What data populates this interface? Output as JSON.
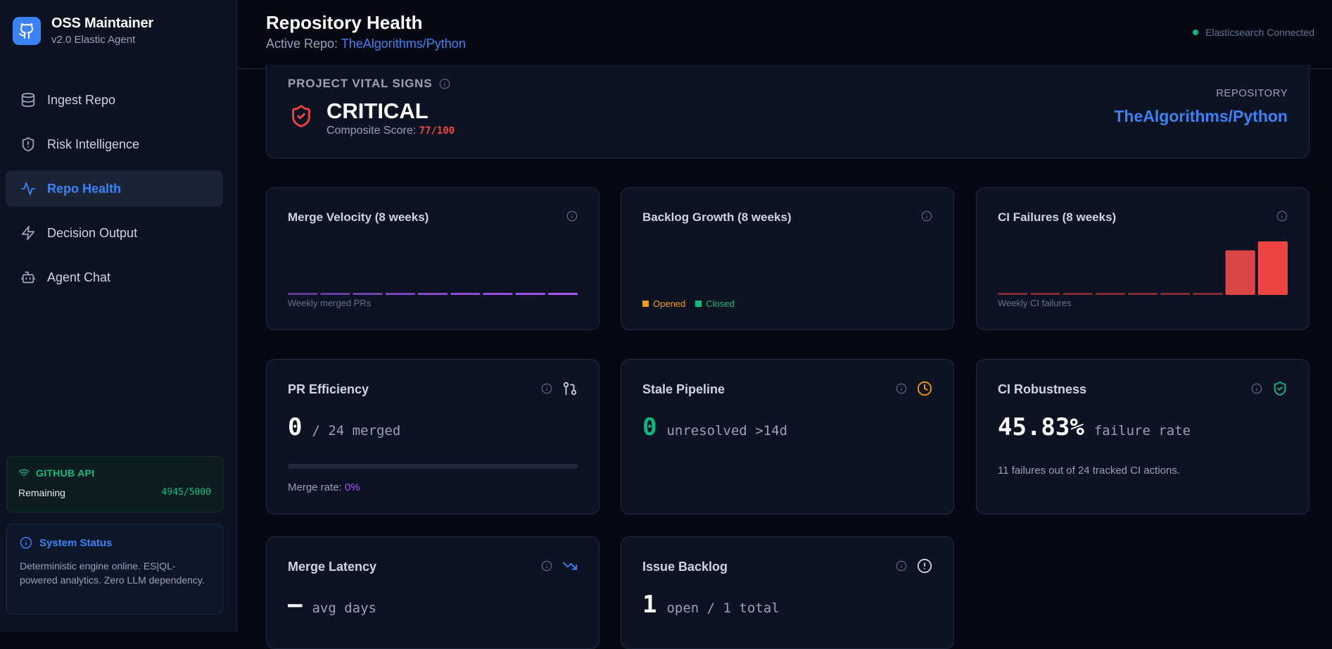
{
  "brand": {
    "title": "OSS Maintainer",
    "subtitle": "v2.0 Elastic Agent"
  },
  "nav": {
    "items": [
      {
        "label": "Ingest Repo",
        "icon": "database-icon"
      },
      {
        "label": "Risk Intelligence",
        "icon": "shield-alert-icon"
      },
      {
        "label": "Repo Health",
        "icon": "activity-icon",
        "active": true
      },
      {
        "label": "Decision Output",
        "icon": "zap-icon"
      },
      {
        "label": "Agent Chat",
        "icon": "bot-icon"
      }
    ]
  },
  "github_api": {
    "title": "GITHUB API",
    "label": "Remaining",
    "value": "4945/5000"
  },
  "system_status": {
    "title": "System Status",
    "text": "Deterministic engine online. ES|QL-powered analytics. Zero LLM dependency."
  },
  "header": {
    "title": "Repository Health",
    "active_repo_label": "Active Repo:",
    "active_repo": "TheAlgorithms/Python",
    "connection": "Elasticsearch Connected"
  },
  "vital": {
    "label": "PROJECT VITAL SIGNS",
    "status": "CRITICAL",
    "score_label": "Composite Score:",
    "score": "77/100",
    "repo_label": "REPOSITORY",
    "repo": "TheAlgorithms/Python"
  },
  "cards": {
    "merge_velocity": {
      "title": "Merge Velocity (8 weeks)",
      "caption": "Weekly merged PRs"
    },
    "backlog_growth": {
      "title": "Backlog Growth (8 weeks)",
      "legend_opened": "Opened",
      "legend_closed": "Closed"
    },
    "ci_failures": {
      "title": "CI Failures (8 weeks)",
      "caption": "Weekly CI failures"
    },
    "pr_efficiency": {
      "title": "PR Efficiency",
      "value": "0",
      "unit": "/ 24 merged",
      "merge_rate_label": "Merge rate:",
      "merge_rate": "0%",
      "progress": 0
    },
    "stale_pipeline": {
      "title": "Stale Pipeline",
      "value": "0",
      "unit": "unresolved >14d"
    },
    "ci_robustness": {
      "title": "CI Robustness",
      "value": "45.83%",
      "unit": "failure rate",
      "note": "11 failures out of 24 tracked CI actions."
    },
    "merge_latency": {
      "title": "Merge Latency",
      "value": "—",
      "unit": "avg days"
    },
    "issue_backlog": {
      "title": "Issue Backlog",
      "value": "1",
      "unit": "open / 1 total"
    }
  },
  "colors": {
    "accent": "#3b82f6",
    "success": "#10b981",
    "danger": "#ef4444",
    "purple": "#a855f7",
    "warning": "#f59e0b"
  },
  "chart_data": [
    {
      "type": "bar",
      "title": "Merge Velocity (8 weeks)",
      "caption": "Weekly merged PRs",
      "values": [
        0,
        0,
        0,
        0,
        0,
        0,
        0,
        0,
        0
      ]
    },
    {
      "type": "bar",
      "title": "Backlog Growth (8 weeks)",
      "series": [
        {
          "name": "Opened",
          "values": []
        },
        {
          "name": "Closed",
          "values": []
        }
      ]
    },
    {
      "type": "bar",
      "title": "CI Failures (8 weeks)",
      "caption": "Weekly CI failures",
      "values": [
        0,
        0,
        0,
        0,
        0,
        0,
        0,
        5,
        6
      ]
    }
  ]
}
